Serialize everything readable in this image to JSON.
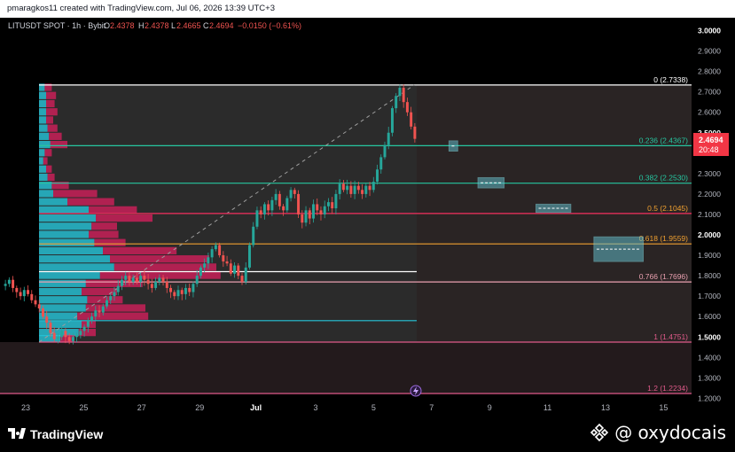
{
  "header": {
    "caption": "pmaragkos11 created with TradingView.com, Jul 06, 2026 13:39 UTC+3"
  },
  "legend": {
    "symbol": "LITUSDT SPOT · 1h · Bybit",
    "o_label": "O",
    "h_label": "H",
    "l_label": "L",
    "c_label": "C",
    "o_value": "2.4378",
    "h_value": "2.4378",
    "l_value": "2.4665",
    "c_value": "2.4694",
    "change": "−0.0150 (−0.61%)",
    "accent_green": "#26a69a",
    "accent_red": "#ef5350"
  },
  "price_tag": {
    "price": "2.4694",
    "countdown": "20:48",
    "color": "#f23645"
  },
  "footer": {
    "brand": "TradingView",
    "watermark": "@ oxydocais",
    "brand_icon": "tradingview-logo-icon",
    "watermark_icon": "binance-logo-icon"
  },
  "chart_data": {
    "type": "candlestick",
    "interval": "1h",
    "y_axis": {
      "range": [
        1.2,
        3.0
      ],
      "ticks": [
        "3.0000",
        "2.9000",
        "2.8000",
        "2.7000",
        "2.6000",
        "2.5000",
        "2.4000",
        "2.3000",
        "2.2000",
        "2.1000",
        "2.0000",
        "1.9000",
        "1.8000",
        "1.7000",
        "1.6000",
        "1.5000",
        "1.4000",
        "1.3000",
        "1.2000"
      ]
    },
    "x_axis": {
      "labels": [
        "23",
        "25",
        "27",
        "29",
        "Jul",
        "3",
        "5",
        "7",
        "9",
        "11",
        "13",
        "15"
      ]
    },
    "fibonacci": [
      {
        "ratio": "0",
        "price": 2.7338,
        "label": "0 (2.7338)",
        "color": "#ffffff"
      },
      {
        "ratio": "0.236",
        "price": 2.4367,
        "label": "0.236 (2.4367)",
        "color": "#26c6a0"
      },
      {
        "ratio": "0.382",
        "price": 2.253,
        "label": "0.382 (2.2530)",
        "color": "#26c6a0"
      },
      {
        "ratio": "0.5",
        "price": 2.1045,
        "label": "0.5 (2.1045)",
        "color": "#f0a030"
      },
      {
        "ratio": "0.618",
        "price": 1.9559,
        "label": "0.618 (1.9559)",
        "color": "#f0a030"
      },
      {
        "ratio": "0.766",
        "price": 1.7696,
        "label": "0.766 (1.7696)",
        "color": "#e9a0b0"
      },
      {
        "ratio": "1",
        "price": 1.4751,
        "label": "1 (1.4751)",
        "color": "#e05a8a"
      },
      {
        "ratio": "1.2",
        "price": 1.2234,
        "label": "1.2 (1.2234)",
        "color": "#e05a8a"
      }
    ],
    "horizontal_lines": [
      {
        "price": 2.105,
        "color": "#e91e63"
      },
      {
        "price": 1.82,
        "color": "#ffffff"
      },
      {
        "price": 1.58,
        "color": "#26c6da"
      }
    ],
    "target_boxes": [
      {
        "day_start": 14.6,
        "day_end": 14.9,
        "price_low": 2.41,
        "price_high": 2.46
      },
      {
        "day_start": 15.6,
        "day_end": 16.5,
        "price_low": 2.23,
        "price_high": 2.28
      },
      {
        "day_start": 17.6,
        "day_end": 18.8,
        "price_low": 2.11,
        "price_high": 2.15
      },
      {
        "day_start": 19.6,
        "day_end": 21.3,
        "price_low": 1.87,
        "price_high": 1.99
      }
    ],
    "volume_profile": {
      "rows": [
        {
          "price": 2.72,
          "up": 0.04,
          "down": 0.05
        },
        {
          "price": 2.68,
          "up": 0.05,
          "down": 0.07
        },
        {
          "price": 2.64,
          "up": 0.05,
          "down": 0.06
        },
        {
          "price": 2.6,
          "up": 0.05,
          "down": 0.08
        },
        {
          "price": 2.56,
          "up": 0.05,
          "down": 0.05
        },
        {
          "price": 2.52,
          "up": 0.06,
          "down": 0.07
        },
        {
          "price": 2.48,
          "up": 0.07,
          "down": 0.09
        },
        {
          "price": 2.44,
          "up": 0.08,
          "down": 0.12
        },
        {
          "price": 2.4,
          "up": 0.04,
          "down": 0.05
        },
        {
          "price": 2.36,
          "up": 0.03,
          "down": 0.03
        },
        {
          "price": 2.32,
          "up": 0.05,
          "down": 0.04
        },
        {
          "price": 2.28,
          "up": 0.06,
          "down": 0.05
        },
        {
          "price": 2.24,
          "up": 0.09,
          "down": 0.12
        },
        {
          "price": 2.2,
          "up": 0.1,
          "down": 0.31
        },
        {
          "price": 2.16,
          "up": 0.2,
          "down": 0.33
        },
        {
          "price": 2.12,
          "up": 0.35,
          "down": 0.34
        },
        {
          "price": 2.08,
          "up": 0.4,
          "down": 0.4
        },
        {
          "price": 2.04,
          "up": 0.37,
          "down": 0.18
        },
        {
          "price": 2.0,
          "up": 0.35,
          "down": 0.21
        },
        {
          "price": 1.96,
          "up": 0.39,
          "down": 0.22
        },
        {
          "price": 1.92,
          "up": 0.45,
          "down": 0.52
        },
        {
          "price": 1.88,
          "up": 0.5,
          "down": 0.7
        },
        {
          "price": 1.84,
          "up": 0.53,
          "down": 0.72
        },
        {
          "price": 1.8,
          "up": 0.43,
          "down": 0.85
        },
        {
          "price": 1.76,
          "up": 0.33,
          "down": 0.4
        },
        {
          "price": 1.72,
          "up": 0.3,
          "down": 0.25
        },
        {
          "price": 1.68,
          "up": 0.34,
          "down": 0.25
        },
        {
          "price": 1.64,
          "up": 0.33,
          "down": 0.42
        },
        {
          "price": 1.6,
          "up": 0.27,
          "down": 0.5
        },
        {
          "price": 1.56,
          "up": 0.3,
          "down": 0.1
        },
        {
          "price": 1.52,
          "up": 0.28,
          "down": 0.12
        },
        {
          "price": 1.49,
          "up": 0.15,
          "down": 0.1
        }
      ]
    },
    "candles_close": [
      1.76,
      1.78,
      1.74,
      1.72,
      1.7,
      1.73,
      1.71,
      1.68,
      1.66,
      1.64,
      1.6,
      1.57,
      1.52,
      1.49,
      1.5,
      1.53,
      1.5,
      1.48,
      1.5,
      1.51,
      1.53,
      1.55,
      1.58,
      1.6,
      1.63,
      1.62,
      1.65,
      1.68,
      1.7,
      1.72,
      1.75,
      1.78,
      1.8,
      1.77,
      1.79,
      1.77,
      1.8,
      1.78,
      1.76,
      1.74,
      1.77,
      1.79,
      1.77,
      1.74,
      1.72,
      1.7,
      1.73,
      1.71,
      1.74,
      1.72,
      1.76,
      1.8,
      1.84,
      1.86,
      1.89,
      1.93,
      1.95,
      1.9,
      1.87,
      1.86,
      1.81,
      1.85,
      1.8,
      1.77,
      1.84,
      1.95,
      2.04,
      2.12,
      2.1,
      2.15,
      2.12,
      2.17,
      2.2,
      2.14,
      2.12,
      2.18,
      2.22,
      2.2,
      2.1,
      2.06,
      2.12,
      2.08,
      2.15,
      2.12,
      2.1,
      2.14,
      2.16,
      2.13,
      2.2,
      2.25,
      2.22,
      2.24,
      2.2,
      2.24,
      2.22,
      2.2,
      2.24,
      2.22,
      2.26,
      2.32,
      2.38,
      2.44,
      2.5,
      2.62,
      2.68,
      2.72,
      2.65,
      2.6,
      2.53,
      2.47
    ]
  }
}
